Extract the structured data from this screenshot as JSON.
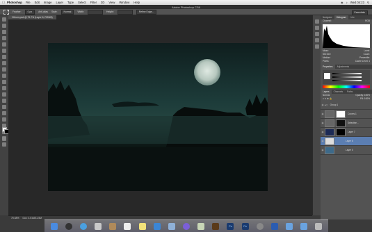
{
  "menubar": {
    "apple": "",
    "app": "Photoshop",
    "items": [
      "File",
      "Edit",
      "Image",
      "Layer",
      "Type",
      "Select",
      "Filter",
      "3D",
      "View",
      "Window",
      "Help"
    ],
    "clock": "Wed 04:23"
  },
  "window": {
    "title": "Adobe Photoshop CS6"
  },
  "options": {
    "feather_label": "Feather:",
    "feather_value": "0 px",
    "antialias_label": "Anti-alias",
    "style_label": "Style:",
    "style_value": "Normal",
    "width_label": "Width:",
    "height_label": "Height:",
    "refine_button": "Refine Edge...",
    "workspace": "Essentials"
  },
  "document": {
    "tab": "Cliburn.psd @ 75.7% (Layer 6, RGB/8)",
    "zoom": "75.68%",
    "doc_size": "Doc: 3.51M/11.5M"
  },
  "panels": {
    "top_tabs": [
      "Navigator",
      "Histogram",
      "Info"
    ],
    "source_label": "Channel:",
    "source_value": "RGB",
    "stats": [
      [
        "Mean:",
        "Level:"
      ],
      [
        "Std Dev:",
        "Count:"
      ],
      [
        "Median:",
        "Percentile:"
      ],
      [
        "Pixels:",
        "Cache Level: 1"
      ]
    ],
    "adj_tabs": [
      "Properties",
      "Adjustments"
    ],
    "color_tabs": [
      "Swatches",
      "Styles",
      "Color"
    ],
    "layers_tabs": [
      "Layers",
      "Channels",
      "Paths"
    ],
    "blend": "Normal",
    "opacity_label": "Opacity:",
    "opacity_value": "100%",
    "fill_label": "Fill:",
    "fill_value": "100%",
    "layers": [
      {
        "name": "Group 1",
        "selected": false
      },
      {
        "name": "Curves 1",
        "selected": false
      },
      {
        "name": "Selective...",
        "selected": false
      },
      {
        "name": "Layer 7",
        "selected": false
      },
      {
        "name": "Layer 6",
        "selected": true
      },
      {
        "name": "Layer 0",
        "selected": false
      }
    ]
  },
  "colors": {
    "accent": "#5b7eb2",
    "canvas_dark": "#0f1e1e"
  }
}
